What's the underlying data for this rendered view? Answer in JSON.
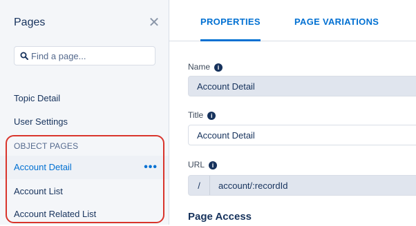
{
  "sidebar": {
    "title": "Pages",
    "search_placeholder": "Find a page...",
    "items": [
      {
        "label": "Topic Detail"
      },
      {
        "label": "User Settings"
      }
    ],
    "section_label": "OBJECT PAGES",
    "object_items": [
      {
        "label": "Account Detail",
        "active": true
      },
      {
        "label": "Account List"
      },
      {
        "label": "Account Related List"
      }
    ],
    "more_glyph": "•••"
  },
  "tabs": [
    {
      "label": "PROPERTIES",
      "active": true
    },
    {
      "label": "PAGE VARIATIONS"
    }
  ],
  "properties": {
    "name_label": "Name",
    "name_value": "Account Detail",
    "title_label": "Title",
    "title_value": "Account Detail",
    "url_label": "URL",
    "url_prefix": "/",
    "url_value": "account/:recordId",
    "page_access_heading": "Page Access"
  },
  "colors": {
    "accent": "#0070d2",
    "highlight_outline": "#d9342b",
    "sidebar_bg": "#f4f6f9"
  }
}
